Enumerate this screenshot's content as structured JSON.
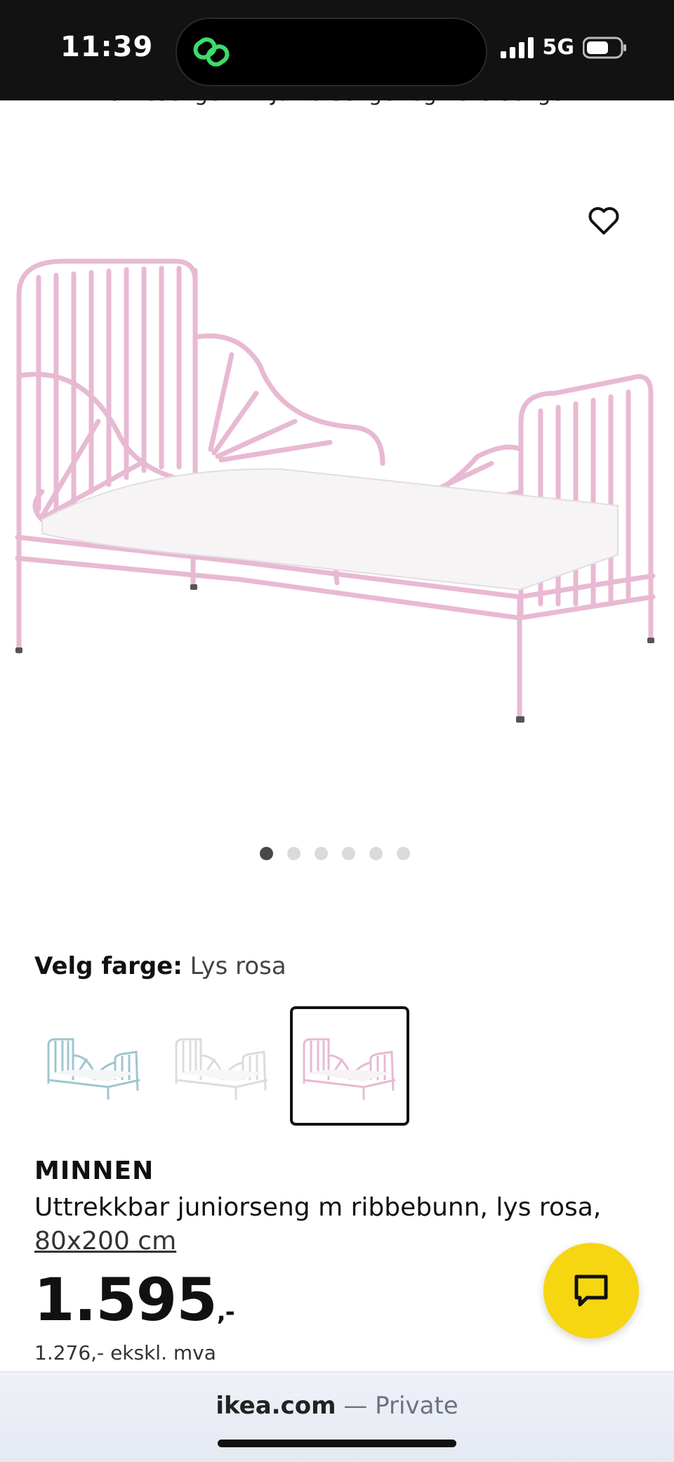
{
  "status_bar": {
    "time": "11:39",
    "network": "5G",
    "icons": [
      "signal-icon",
      "battery-icon",
      "link-app-icon"
    ]
  },
  "breadcrumb": {
    "items": [
      "...",
      "Barnesenger",
      "Juniorsenger og vekstsenger"
    ],
    "separator": "›"
  },
  "gallery": {
    "image_count": 6,
    "active_index": 0
  },
  "color_picker": {
    "label": "Velg farge:",
    "selected": "Lys rosa",
    "options": [
      {
        "name": "Lys turkis",
        "color": "#9fc6cf"
      },
      {
        "name": "Hvit",
        "color": "#e6e6e6"
      },
      {
        "name": "Lys rosa",
        "color": "#e8b9d3"
      }
    ]
  },
  "product": {
    "name": "MINNEN",
    "description": "Uttrekkbar juniorseng m ribbebunn, lys rosa,",
    "size": "80x200 cm",
    "price": "1.595",
    "price_suffix": ",-",
    "price_excl_vat": "1.276,- ekskl. mva"
  },
  "url_bar": {
    "domain": "ikea.com",
    "mode": "— Private"
  },
  "colors": {
    "accent_yellow": "#f6d610",
    "bed_pink": "#e8b9d3"
  }
}
